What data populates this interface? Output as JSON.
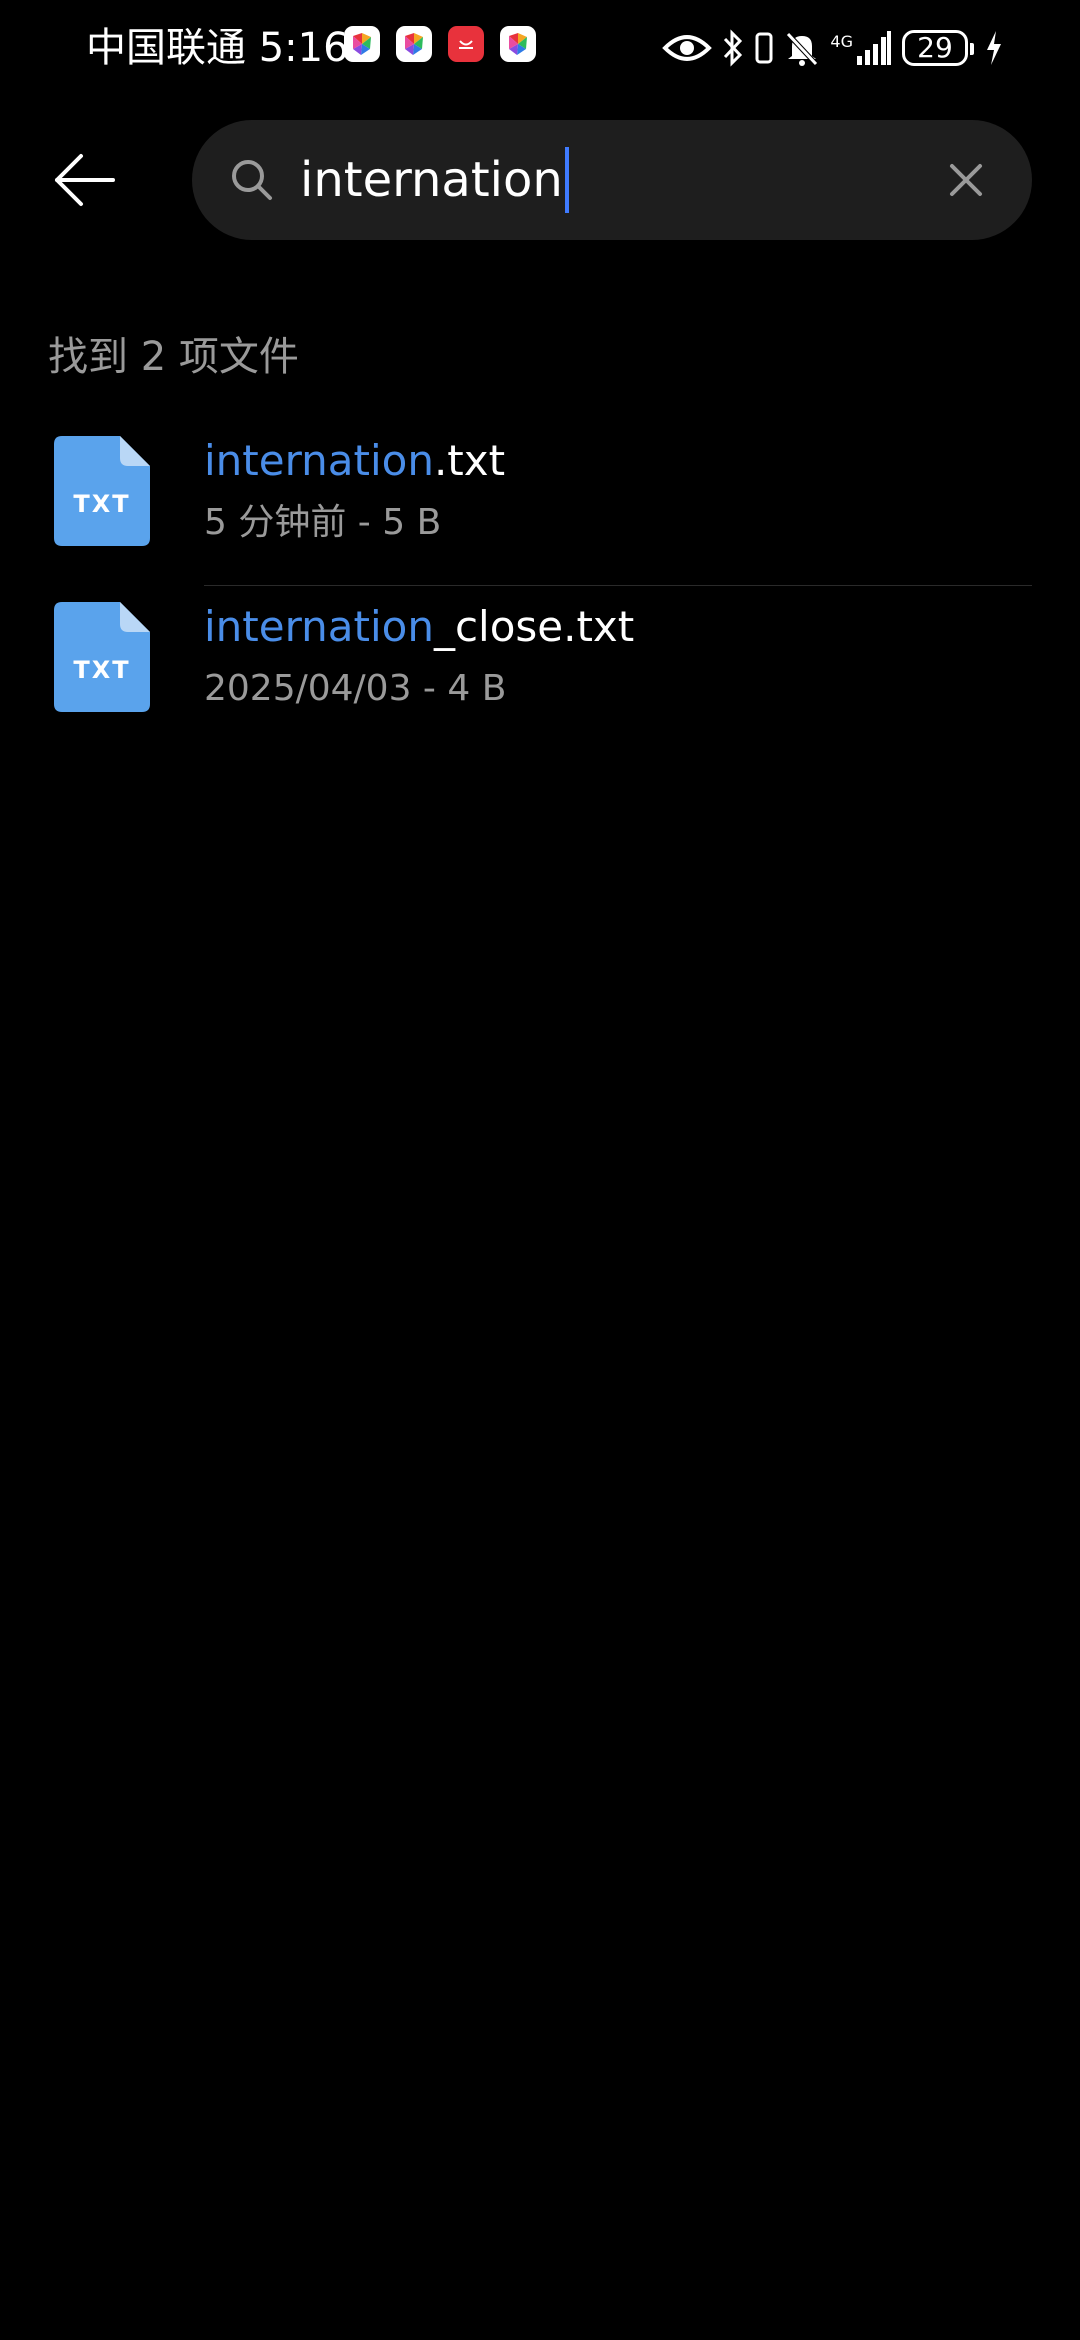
{
  "status_bar": {
    "carrier_time": "中国联通 5:16",
    "network": "4G",
    "battery": "29",
    "notification_icons": [
      "app-notification-icon",
      "app-notification-icon",
      "huawei-store-icon",
      "app-notification-icon"
    ],
    "system_icons": [
      "eye-comfort-icon",
      "bluetooth-icon",
      "vibrate-icon",
      "mute-icon",
      "signal-icon",
      "battery-icon",
      "charging-icon"
    ]
  },
  "header": {
    "back_icon": "back-arrow-icon",
    "search": {
      "query": "internation",
      "search_icon": "search-icon",
      "clear_icon": "close-icon"
    }
  },
  "results": {
    "count_label": "找到 2 项文件",
    "highlight_color": "#4a8de8",
    "files": [
      {
        "name_match": "internation",
        "name_rest": ".txt",
        "meta": "5 分钟前 - 5 B",
        "icon": "txt-file-icon",
        "icon_label": "TXT"
      },
      {
        "name_match": "internation",
        "name_rest": "_close.txt",
        "meta": "2025/04/03 - 4 B",
        "icon": "txt-file-icon",
        "icon_label": "TXT"
      }
    ]
  }
}
